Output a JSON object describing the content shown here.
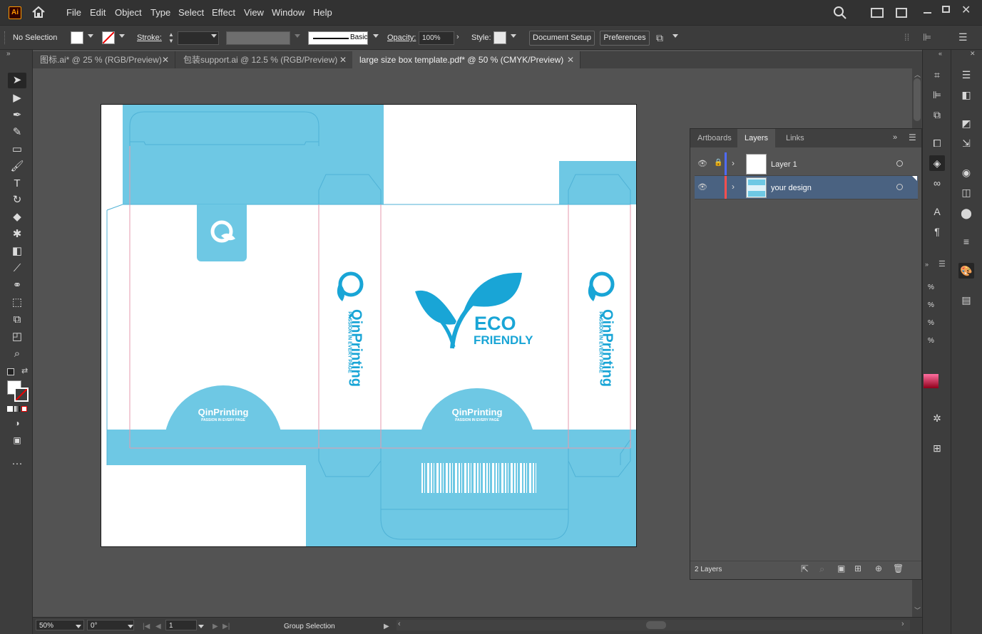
{
  "menu": {
    "items": [
      "File",
      "Edit",
      "Object",
      "Type",
      "Select",
      "Effect",
      "View",
      "Window",
      "Help"
    ]
  },
  "app": {
    "logo": "Ai"
  },
  "control": {
    "selection": "No Selection",
    "stroke_label": "Stroke:",
    "brush": "Basic",
    "opacity_label": "Opacity:",
    "opacity_value": "100%",
    "style_label": "Style:",
    "doc_setup": "Document Setup",
    "preferences": "Preferences"
  },
  "tabs": [
    {
      "label": "图标.ai* @ 25 % (RGB/Preview)"
    },
    {
      "label": "包装support.ai @ 12.5 % (RGB/Preview)"
    },
    {
      "label": "large size box template.pdf* @ 50 % (CMYK/Preview)"
    }
  ],
  "artwork": {
    "brand": "QinPrinting",
    "tagline": "PASSION IN EVERY PAGE",
    "eco1": "ECO",
    "eco2": "FRIENDLY"
  },
  "layers_panel": {
    "tabs": [
      "Artboards",
      "Layers",
      "Links"
    ],
    "rows": [
      {
        "name": "Layer 1",
        "color": "#4f6bff"
      },
      {
        "name": "your design",
        "color": "#ff4f4f"
      }
    ],
    "count": "2 Layers"
  },
  "status": {
    "zoom": "50%",
    "rotation": "0°",
    "artboard": "1",
    "tool": "Group Selection"
  },
  "colors": {
    "box_blue": "#6ec8e4",
    "logo_blue": "#19a5d6"
  }
}
